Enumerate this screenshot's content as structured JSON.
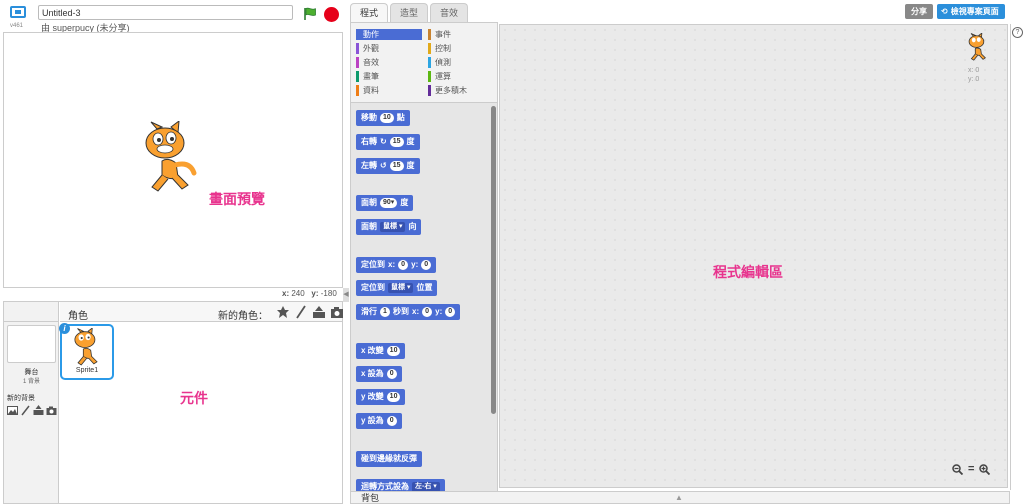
{
  "header": {
    "version": "v461",
    "project_title": "Untitled-3",
    "author_line": "由 superpucy (未分享)"
  },
  "stage": {
    "label": "畫面預覽",
    "x_label": "x:",
    "x_value": "240",
    "y_label": "y:",
    "y_value": "-180"
  },
  "sprite_pane": {
    "title": "角色",
    "new_sprite_label": "新的角色：",
    "stage_name": "舞台",
    "stage_backdrop_count": "1 背景",
    "new_backdrop_label": "新的背景",
    "sprite_name": "Sprite1",
    "label": "元件"
  },
  "tabs": [
    {
      "label": "程式"
    },
    {
      "label": "造型"
    },
    {
      "label": "音效"
    }
  ],
  "categories": [
    {
      "label": "動作",
      "color": "#4a6cd4"
    },
    {
      "label": "事件",
      "color": "#c88330"
    },
    {
      "label": "外觀",
      "color": "#8a55d7"
    },
    {
      "label": "控制",
      "color": "#e1a91a"
    },
    {
      "label": "音效",
      "color": "#bb42c3"
    },
    {
      "label": "偵測",
      "color": "#2ca5e2"
    },
    {
      "label": "畫筆",
      "color": "#0e9a6c"
    },
    {
      "label": "運算",
      "color": "#5cb712"
    },
    {
      "label": "資料",
      "color": "#ee7d16"
    },
    {
      "label": "更多積木",
      "color": "#632d99"
    }
  ],
  "blocks": {
    "move": {
      "a": "移動",
      "n": "10",
      "b": "點"
    },
    "turn_right": {
      "a": "右轉",
      "n": "15",
      "b": "度"
    },
    "turn_left": {
      "a": "左轉",
      "n": "15",
      "b": "度"
    },
    "point_dir": {
      "a": "面朝",
      "n": "90▾",
      "b": "度"
    },
    "point_towards": {
      "a": "面朝",
      "dd": "鼠標 ▾",
      "b": "向"
    },
    "goto_xy": {
      "a": "定位到",
      "x": "x:",
      "xv": "0",
      "y": "y:",
      "yv": "0"
    },
    "goto_obj": {
      "a": "定位到",
      "dd": "鼠標 ▾",
      "b": "位置"
    },
    "glide": {
      "a": "滑行",
      "n": "1",
      "b": "秒到",
      "x": "x:",
      "xv": "0",
      "y": "y:",
      "yv": "0"
    },
    "change_x": {
      "a": "x 改變",
      "n": "10"
    },
    "set_x": {
      "a": "x 設為",
      "n": "0"
    },
    "change_y": {
      "a": "y 改變",
      "n": "10"
    },
    "set_y": {
      "a": "y 設為",
      "n": "0"
    },
    "bounce": {
      "a": "碰到邊緣就反彈"
    },
    "rotation": {
      "a": "迴轉方式設為",
      "dd": "左-右 ▾"
    }
  },
  "script_area": {
    "label": "程式編輯區",
    "x_label": "x: 0",
    "y_label": "y: 0"
  },
  "topright": {
    "share_label": "分享",
    "view_page_label": "檢視專案頁面"
  },
  "backpack": {
    "label": "背包"
  },
  "colors": {
    "motion": "#4a6cd4",
    "annotation": "#e8348e",
    "accent": "#2b8fdb"
  }
}
